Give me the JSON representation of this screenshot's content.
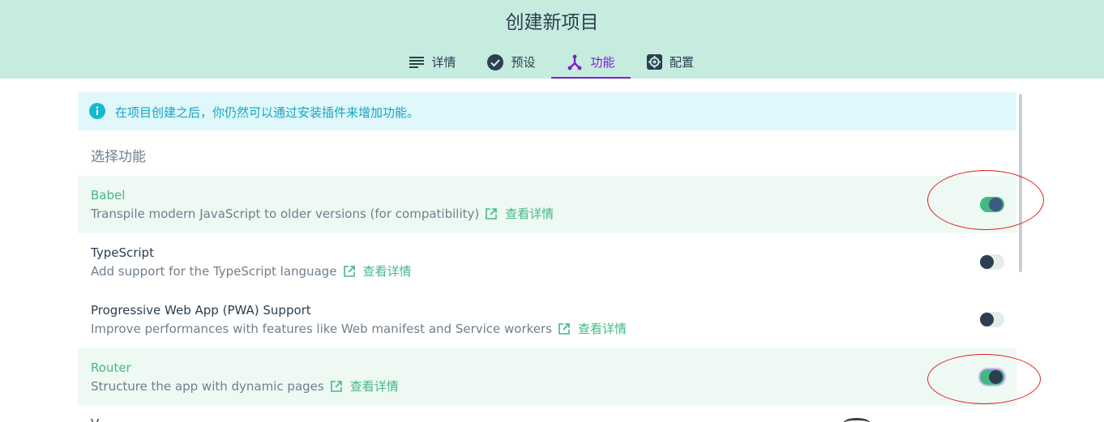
{
  "header": {
    "title": "创建新项目",
    "tabs": [
      {
        "label": "详情",
        "icon": "list-icon",
        "active": false
      },
      {
        "label": "预设",
        "icon": "check-circle-icon",
        "active": false
      },
      {
        "label": "功能",
        "icon": "merge-icon",
        "active": true
      },
      {
        "label": "配置",
        "icon": "gear-icon",
        "active": false
      }
    ]
  },
  "info_banner": {
    "icon": "info-icon",
    "text": "在项目创建之后，你仍然可以通过安装插件来增加功能。"
  },
  "features": {
    "section_title": "选择功能",
    "more_label": "查看详情",
    "items": [
      {
        "name": "Babel",
        "description": "Transpile modern JavaScript to older versions (for compatibility)",
        "enabled": true
      },
      {
        "name": "TypeScript",
        "description": "Add support for the TypeScript language",
        "enabled": false
      },
      {
        "name": "Progressive Web App (PWA) Support",
        "description": "Improve performances with features like Web manifest and Service workers",
        "enabled": false
      },
      {
        "name": "Router",
        "description": "Structure the app with dynamic pages",
        "enabled": true
      }
    ],
    "partial_next_item": "V"
  },
  "colors": {
    "header_bg": "#c6ebdf",
    "accent_purple": "#7b1fd0",
    "accent_green": "#42b983",
    "info_bg": "#e0f8fb",
    "info_text": "#16a3c0",
    "annotation_red": "#e02020"
  }
}
